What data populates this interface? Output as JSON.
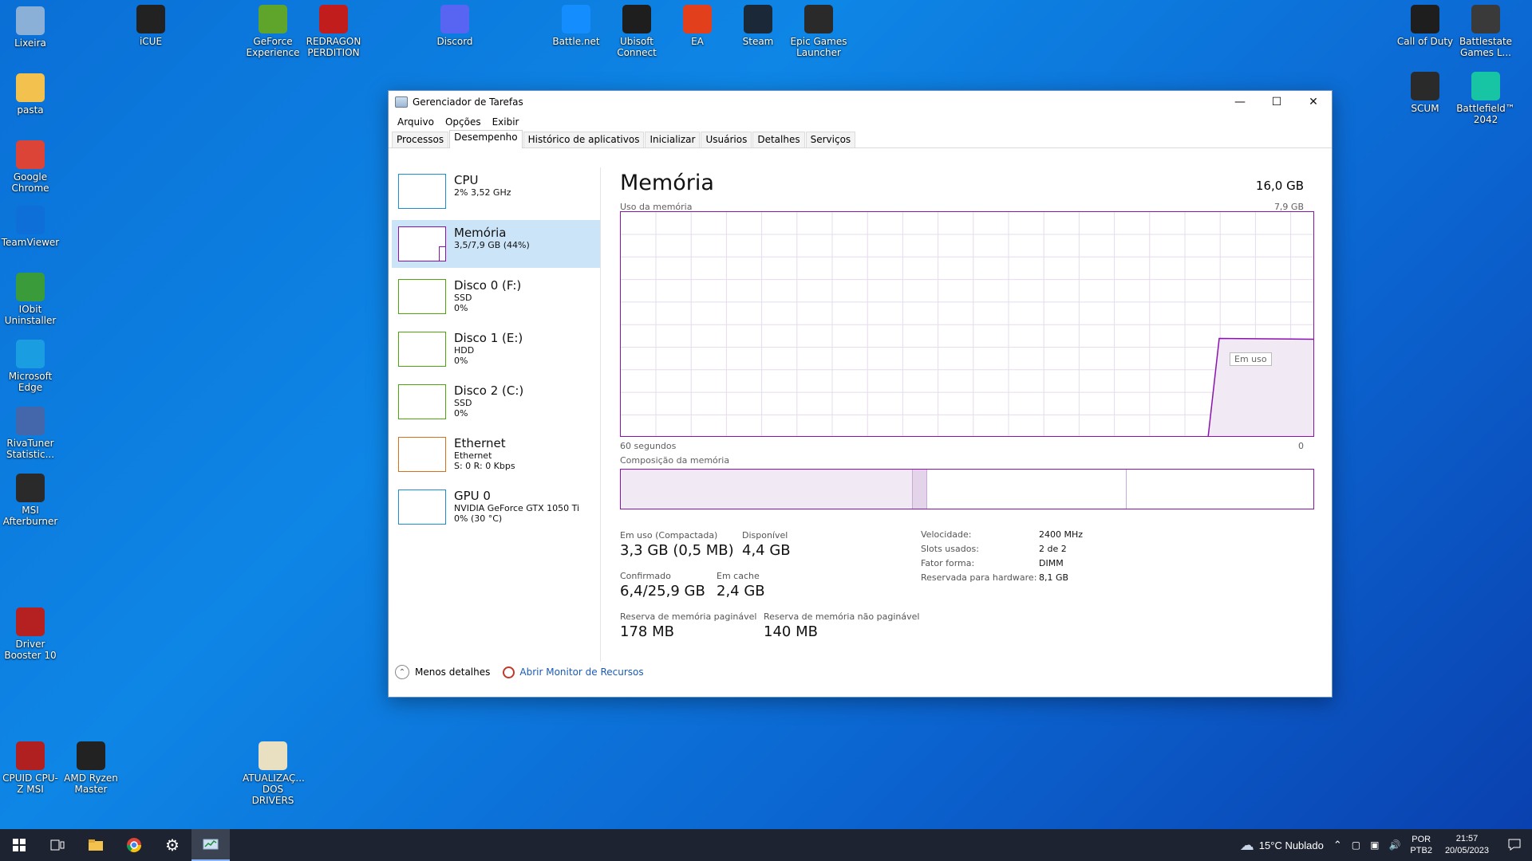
{
  "desktop": {
    "icons_left": [
      {
        "label": "Lixeira",
        "icon": "recycle-bin-icon",
        "color": "#8ab0d8"
      },
      {
        "label": "pasta",
        "icon": "folder-icon",
        "color": "#f2c14e"
      },
      {
        "label": "Google Chrome",
        "icon": "chrome-icon",
        "color": "#db4437"
      },
      {
        "label": "TeamViewer",
        "icon": "teamviewer-icon",
        "color": "#0e6fd8"
      },
      {
        "label": "IObit Uninstaller",
        "icon": "iobit-icon",
        "color": "#3a9b3a"
      },
      {
        "label": "Microsoft Edge",
        "icon": "edge-icon",
        "color": "#1b9de2"
      },
      {
        "label": "RivaTuner Statistic...",
        "icon": "rivatuner-icon",
        "color": "#4466aa"
      },
      {
        "label": "MSI Afterburner",
        "icon": "afterburner-icon",
        "color": "#2a2a2a"
      },
      {
        "label": "Driver Booster 10",
        "icon": "driver-booster-icon",
        "color": "#b52020"
      }
    ],
    "icons_top": [
      {
        "label": "iCUE",
        "icon": "icue-icon",
        "color": "#222222"
      },
      {
        "label": "GeForce Experience",
        "icon": "geforce-icon",
        "color": "#5fa52c"
      },
      {
        "label": "REDRAGON PERDITION",
        "icon": "redragon-icon",
        "color": "#c21d1d"
      },
      {
        "label": "Discord",
        "icon": "discord-icon",
        "color": "#5865f2"
      },
      {
        "label": "Battle.net",
        "icon": "battlenet-icon",
        "color": "#148eff"
      },
      {
        "label": "Ubisoft Connect",
        "icon": "ubisoft-icon",
        "color": "#1e1e1e"
      },
      {
        "label": "EA",
        "icon": "ea-icon",
        "color": "#e2401c"
      },
      {
        "label": "Steam",
        "icon": "steam-icon",
        "color": "#1b2838"
      },
      {
        "label": "Epic Games Launcher",
        "icon": "epic-icon",
        "color": "#2a2a2a"
      }
    ],
    "icons_right": [
      {
        "label": "Call of Duty",
        "icon": "cod-icon",
        "color": "#1e1e1e"
      },
      {
        "label": "Battlestate Games L...",
        "icon": "battlestate-icon",
        "color": "#3a3a3a"
      },
      {
        "label": "SCUM",
        "icon": "scum-icon",
        "color": "#2a2a2a"
      },
      {
        "label": "Battlefield™ 2042",
        "icon": "battlefield-icon",
        "color": "#17c4a4"
      }
    ],
    "icons_bottom": [
      {
        "label": "CPUID CPU-Z MSI",
        "icon": "cpuz-icon",
        "color": "#b02020"
      },
      {
        "label": "AMD Ryzen Master",
        "icon": "ryzen-icon",
        "color": "#222222"
      },
      {
        "label": "ATUALIZAÇ... DOS DRIVERS",
        "icon": "file-icon",
        "color": "#e8e0c0"
      }
    ]
  },
  "window": {
    "title": "Gerenciador de Tarefas",
    "menu": [
      "Arquivo",
      "Opções",
      "Exibir"
    ],
    "tabs": [
      "Processos",
      "Desempenho",
      "Histórico de aplicativos",
      "Inicializar",
      "Usuários",
      "Detalhes",
      "Serviços"
    ],
    "active_tab": "Desempenho",
    "resources": [
      {
        "name": "CPU",
        "line2": "2% 3,52 GHz",
        "line3": "",
        "color": "#1b8fd1",
        "selected": false
      },
      {
        "name": "Memória",
        "line2": "3,5/7,9 GB (44%)",
        "line3": "",
        "color": "#8b12ae",
        "selected": true
      },
      {
        "name": "Disco 0 (F:)",
        "line2": "SSD",
        "line3": "0%",
        "color": "#4da60c",
        "selected": false
      },
      {
        "name": "Disco 1 (E:)",
        "line2": "HDD",
        "line3": "0%",
        "color": "#4da60c",
        "selected": false
      },
      {
        "name": "Disco 2 (C:)",
        "line2": "SSD",
        "line3": "0%",
        "color": "#4da60c",
        "selected": false
      },
      {
        "name": "Ethernet",
        "line2": "Ethernet",
        "line3": "S: 0 R: 0 Kbps",
        "color": "#d86f1a",
        "selected": false
      },
      {
        "name": "GPU 0",
        "line2": "NVIDIA GeForce GTX 1050 Ti",
        "line3": "0% (30 °C)",
        "color": "#1b8fd1",
        "selected": false
      }
    ],
    "memory": {
      "title": "Memória",
      "total": "16,0 GB",
      "usage_label": "Uso da memória",
      "usage_max": "7,9 GB",
      "time_left": "60 segundos",
      "time_right": "0",
      "tooltip": "Em uso",
      "composition_label": "Composição da memória",
      "usage_level": 0.44,
      "stats": {
        "in_use_label": "Em uso (Compactada)",
        "in_use": "3,3 GB (0,5 MB)",
        "available_label": "Disponível",
        "available": "4,4 GB",
        "committed_label": "Confirmado",
        "committed": "6,4/25,9 GB",
        "cached_label": "Em cache",
        "cached": "2,4 GB",
        "paged_label": "Reserva de memória paginável",
        "paged": "178 MB",
        "nonpaged_label": "Reserva de memória não paginável",
        "nonpaged": "140 MB"
      },
      "details": [
        {
          "k": "Velocidade:",
          "v": "2400 MHz"
        },
        {
          "k": "Slots usados:",
          "v": "2 de 2"
        },
        {
          "k": "Fator forma:",
          "v": "DIMM"
        },
        {
          "k": "Reservada para hardware:",
          "v": "8,1 GB"
        }
      ]
    },
    "footer": {
      "less": "Menos detalhes",
      "monitor": "Abrir Monitor de Recursos"
    }
  },
  "taskbar": {
    "weather": "15°C Nublado",
    "lang1": "POR",
    "lang2": "PTB2",
    "time": "21:57",
    "date": "20/05/2023"
  }
}
